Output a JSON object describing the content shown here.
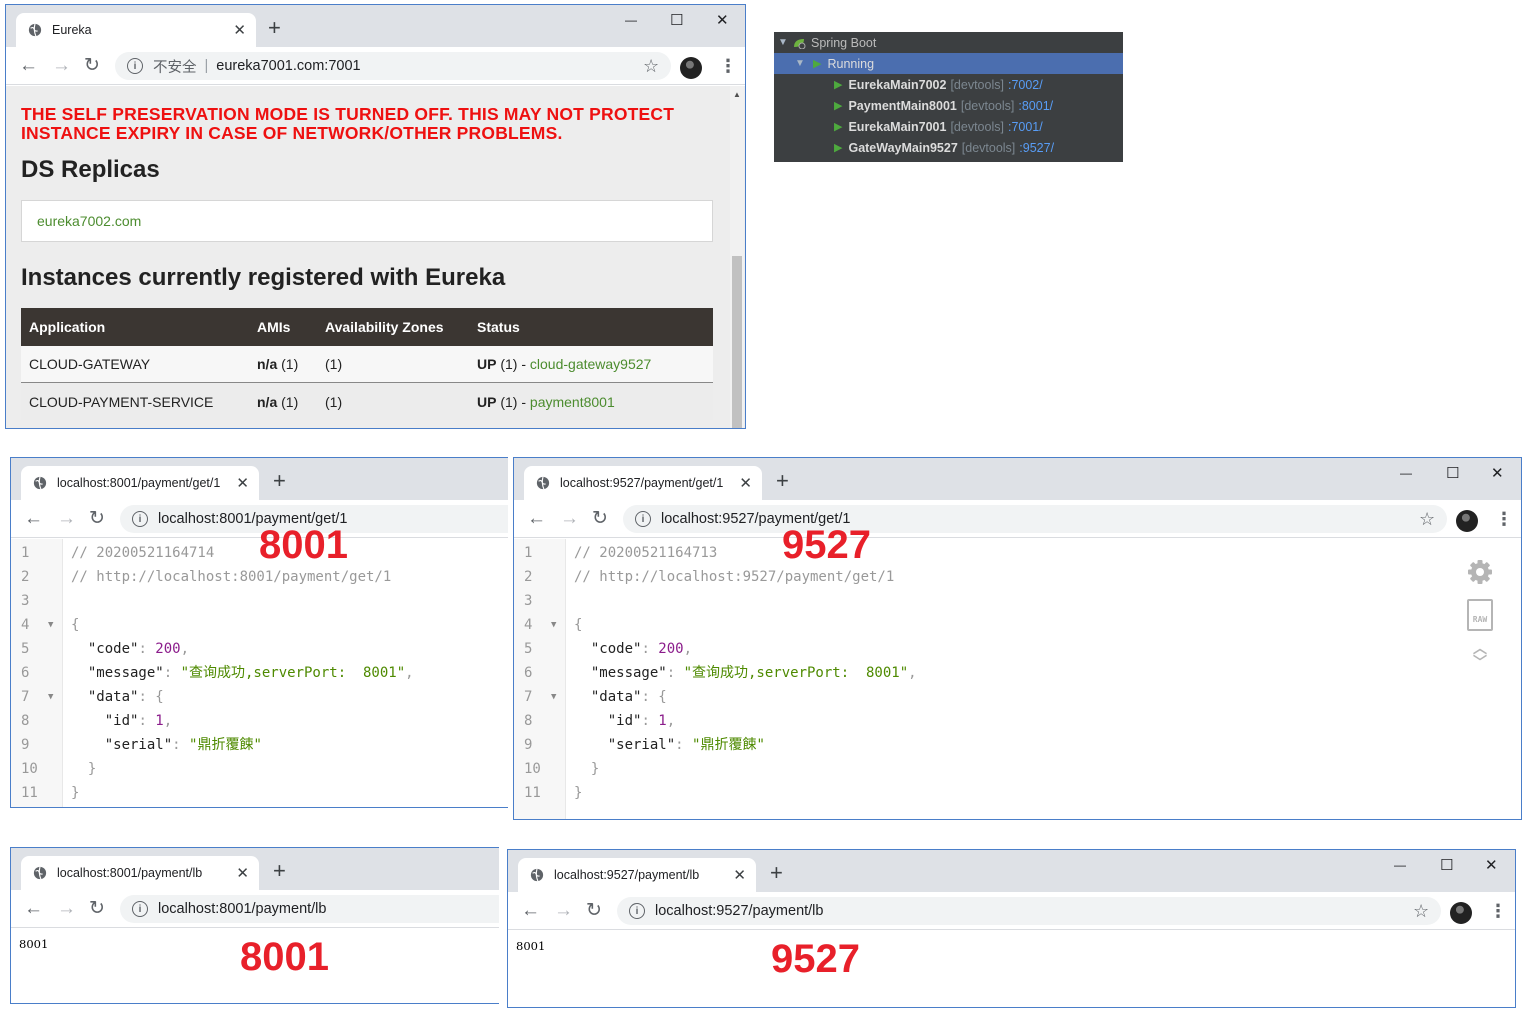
{
  "eureka_window": {
    "tab_title": "Eureka",
    "url_insecure": "不安全",
    "url": "eureka7001.com:7001",
    "warning": "THE SELF PRESERVATION MODE IS TURNED OFF. THIS MAY NOT PROTECT INSTANCE EXPIRY IN CASE OF NETWORK/OTHER PROBLEMS.",
    "replicas_title": "DS Replicas",
    "replica": "eureka7002.com",
    "instances_title": "Instances currently registered with Eureka",
    "columns": [
      "Application",
      "AMIs",
      "Availability Zones",
      "Status"
    ],
    "rows": [
      {
        "application": "CLOUD-GATEWAY",
        "amis_value": "n/a",
        "amis_count": "(1)",
        "zones": "(1)",
        "status": "UP",
        "status_count": "(1) -",
        "instance": "cloud-gateway9527"
      },
      {
        "application": "CLOUD-PAYMENT-SERVICE",
        "amis_value": "n/a",
        "amis_count": "(1)",
        "zones": "(1)",
        "status": "UP",
        "status_count": "(1) -",
        "instance": "payment8001"
      }
    ]
  },
  "spring_boot_panel": {
    "root": "Spring Boot",
    "group": "Running",
    "apps": [
      {
        "name": "EurekaMain7002",
        "tag": "[devtools]",
        "port": ":7002/"
      },
      {
        "name": "PaymentMain8001",
        "tag": "[devtools]",
        "port": ":8001/"
      },
      {
        "name": "EurekaMain7001",
        "tag": "[devtools]",
        "port": ":7001/"
      },
      {
        "name": "GateWayMain9527",
        "tag": "[devtools]",
        "port": ":9527/"
      }
    ]
  },
  "json_8001": {
    "tab_title": "localhost:8001/payment/get/1",
    "url": "localhost:8001/payment/get/1",
    "overlay": "8001",
    "lines": {
      "l1": "// 20200521164714",
      "l2": "// http://localhost:8001/payment/get/1",
      "code_key": "\"code\"",
      "code_val": "200",
      "message_key": "\"message\"",
      "message_val": "\"查询成功,serverPort:  8001\"",
      "data_key": "\"data\"",
      "id_key": "\"id\"",
      "id_val": "1",
      "serial_key": "\"serial\"",
      "serial_val": "\"鼎折覆餗\""
    }
  },
  "json_9527": {
    "tab_title": "localhost:9527/payment/get/1",
    "url": "localhost:9527/payment/get/1",
    "overlay": "9527",
    "lines": {
      "l1": "// 20200521164713",
      "l2": "// http://localhost:9527/payment/get/1",
      "code_key": "\"code\"",
      "code_val": "200",
      "message_key": "\"message\"",
      "message_val": "\"查询成功,serverPort:  8001\"",
      "data_key": "\"data\"",
      "id_key": "\"id\"",
      "id_val": "1",
      "serial_key": "\"serial\"",
      "serial_val": "\"鼎折覆餗\""
    },
    "raw_label": "RAW"
  },
  "lb_8001": {
    "tab_title": "localhost:8001/payment/lb",
    "url": "localhost:8001/payment/lb",
    "body": "8001",
    "overlay": "8001"
  },
  "lb_9527": {
    "tab_title": "localhost:9527/payment/lb",
    "url": "localhost:9527/payment/lb",
    "body": "8001",
    "overlay": "9527"
  },
  "line_numbers": [
    "1",
    "2",
    "3",
    "4",
    "5",
    "6",
    "7",
    "8",
    "9",
    "10",
    "11"
  ],
  "glyphs": {
    "close": "✕",
    "plus": "+",
    "min": "—",
    "max": "☐",
    "back": "←",
    "fwd": "→",
    "reload": "↻",
    "star": "☆",
    "kebab": "⋮",
    "info": "i"
  }
}
